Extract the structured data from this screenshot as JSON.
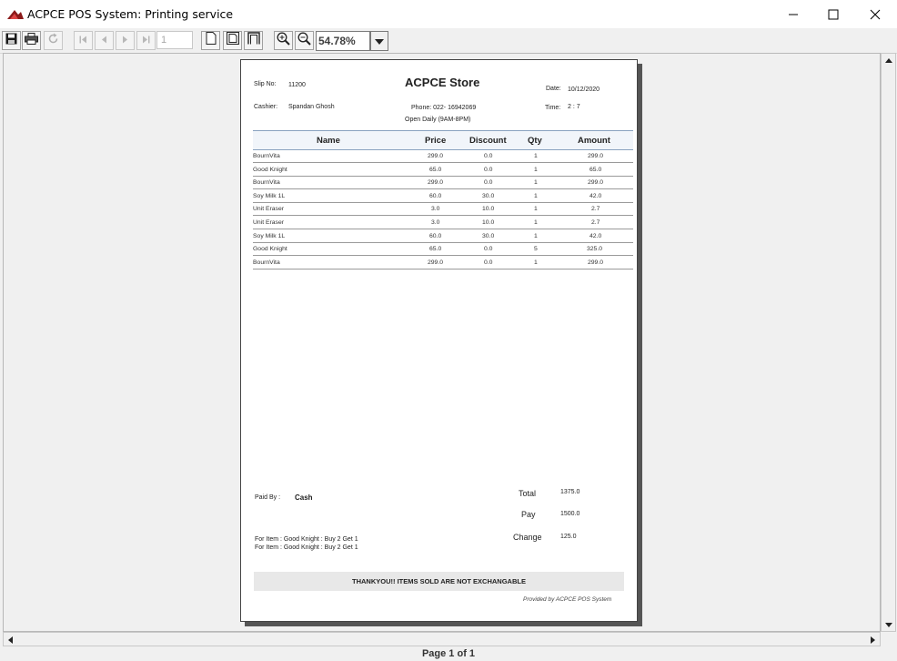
{
  "window": {
    "title": "ACPCE POS System: Printing service"
  },
  "toolbar": {
    "page_number": "1",
    "zoom": "54.78%"
  },
  "receipt": {
    "slip_label": "Slip No:",
    "slip_no": "11200",
    "store_name": "ACPCE Store",
    "date_label": "Date:",
    "date": "10/12/2020",
    "cashier_label": "Cashier:",
    "cashier": "Spandan Ghosh",
    "phone": "Phone: 022- 16942069",
    "time_label": "Time:",
    "time": "2 : 7",
    "hours": "Open Daily (9AM-8PM)",
    "columns": [
      "Name",
      "Price",
      "Discount",
      "Qty",
      "Amount"
    ],
    "items": [
      {
        "name": "BournVita",
        "price": "299.0",
        "discount": "0.0",
        "qty": "1",
        "amount": "299.0"
      },
      {
        "name": "Good Knight",
        "price": "65.0",
        "discount": "0.0",
        "qty": "1",
        "amount": "65.0"
      },
      {
        "name": "BournVita",
        "price": "299.0",
        "discount": "0.0",
        "qty": "1",
        "amount": "299.0"
      },
      {
        "name": "Soy Milk 1L",
        "price": "60.0",
        "discount": "30.0",
        "qty": "1",
        "amount": "42.0"
      },
      {
        "name": "Unit Eraser",
        "price": "3.0",
        "discount": "10.0",
        "qty": "1",
        "amount": "2.7"
      },
      {
        "name": "Unit Eraser",
        "price": "3.0",
        "discount": "10.0",
        "qty": "1",
        "amount": "2.7"
      },
      {
        "name": "Soy Milk 1L",
        "price": "60.0",
        "discount": "30.0",
        "qty": "1",
        "amount": "42.0"
      },
      {
        "name": "Good Knight",
        "price": "65.0",
        "discount": "0.0",
        "qty": "5",
        "amount": "325.0"
      },
      {
        "name": "BournVita",
        "price": "299.0",
        "discount": "0.0",
        "qty": "1",
        "amount": "299.0"
      }
    ],
    "paid_by_label": "Paid By :",
    "paid_by": "Cash",
    "total_label": "Total",
    "total": "1375.0",
    "pay_label": "Pay",
    "pay": "1500.0",
    "change_label": "Change",
    "change": "125.0",
    "offers": [
      "For Item : Good Knight : Buy 2 Get 1",
      "For Item : Good Knight : Buy 2 Get 1"
    ],
    "thanks": "THANKYOU!! ITEMS SOLD ARE NOT EXCHANGABLE",
    "provided_by": "Provided by ACPCE POS System"
  },
  "status": {
    "page_info": "Page 1 of 1"
  }
}
